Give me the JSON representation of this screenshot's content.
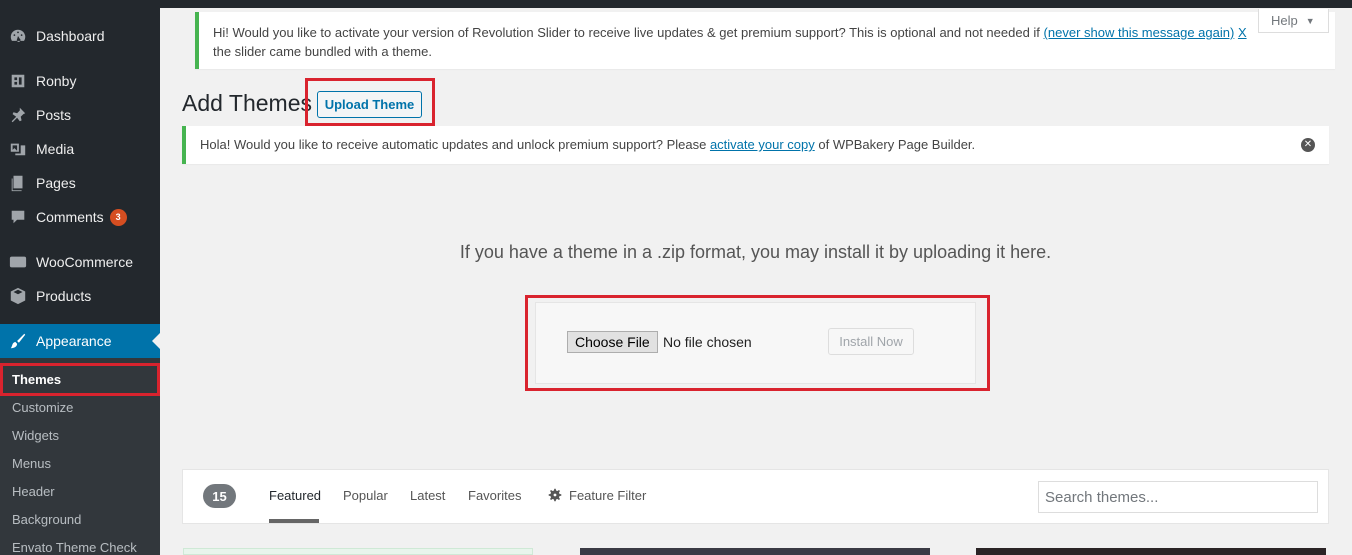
{
  "sidebar": {
    "items": [
      {
        "label": "Dashboard",
        "icon": "dashboard-icon"
      },
      {
        "label": "Ronby",
        "icon": "ronby-icon"
      },
      {
        "label": "Posts",
        "icon": "pin-icon"
      },
      {
        "label": "Media",
        "icon": "media-icon"
      },
      {
        "label": "Pages",
        "icon": "pages-icon"
      },
      {
        "label": "Comments",
        "icon": "comment-icon",
        "badge": "3"
      },
      {
        "label": "WooCommerce",
        "icon": "woo-icon"
      },
      {
        "label": "Products",
        "icon": "box-icon"
      },
      {
        "label": "Appearance",
        "icon": "brush-icon"
      }
    ],
    "submenu": [
      "Themes",
      "Customize",
      "Widgets",
      "Menus",
      "Header",
      "Background",
      "Envato Theme Check"
    ]
  },
  "notices": {
    "revslider_text": "Hi! Would you like to activate your version of Revolution Slider to receive live updates & get premium support? This is optional and not needed if",
    "revslider_link": "(never show this message again)",
    "revslider_close": "X",
    "revslider_text2": "the slider came bundled with a theme.",
    "vc_text1": "Hola! Would you like to receive automatic updates and unlock premium support? Please",
    "vc_link": "activate your copy",
    "vc_text2": "of WPBakery Page Builder."
  },
  "help": {
    "label": "Help"
  },
  "page": {
    "title": "Add Themes",
    "upload_button": "Upload Theme",
    "upload_description": "If you have a theme in a .zip format, you may install it by uploading it here.",
    "choose_file": "Choose File",
    "no_file": "No file chosen",
    "install_now": "Install Now"
  },
  "filter": {
    "count": "15",
    "tabs": [
      "Featured",
      "Popular",
      "Latest",
      "Favorites"
    ],
    "feature_filter": "Feature Filter",
    "search_placeholder": "Search themes..."
  },
  "colors": {
    "sidebar_bg": "#23282d",
    "accent": "#0073aa",
    "highlight": "#d9232e",
    "notice_border": "#46b450"
  }
}
